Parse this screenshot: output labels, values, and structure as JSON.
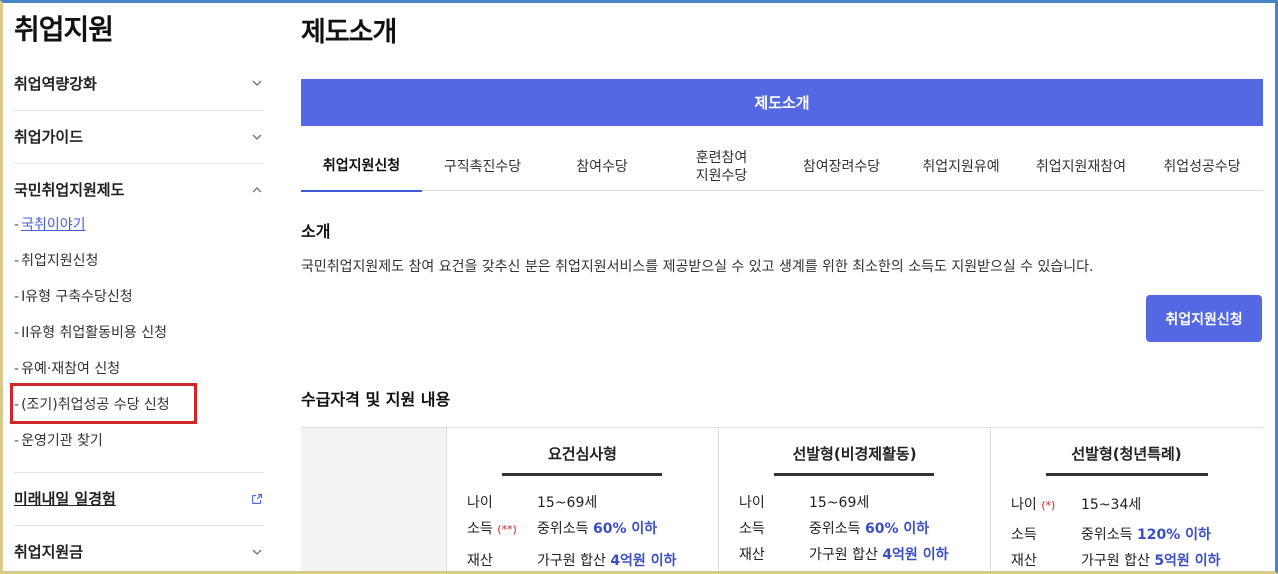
{
  "sidebar": {
    "title": "취업지원",
    "menus": [
      {
        "label": "취업역량강화"
      },
      {
        "label": "취업가이드"
      },
      {
        "label": "국민취업지원제도"
      }
    ],
    "sub_items": [
      {
        "dash": "-",
        "label": "국취이야기"
      },
      {
        "dash": "-",
        "label": "취업지원신청"
      },
      {
        "dash": "-",
        "label": "I유형 구축수당신청"
      },
      {
        "dash": "-",
        "label": "II유형 취업활동비용 신청"
      },
      {
        "dash": "-",
        "label": "유예·재참여 신청"
      },
      {
        "dash": "-",
        "label": "(조기)취업성공 수당 신청"
      },
      {
        "dash": "-",
        "label": "운영기관 찾기"
      }
    ],
    "bottom_menus": [
      {
        "label": "미래내일 일경험"
      },
      {
        "label": "취업지원금"
      }
    ]
  },
  "main": {
    "title": "제도소개",
    "banner": "제도소개",
    "tabs": [
      {
        "label": "취업지원신청"
      },
      {
        "label": "구직촉진수당"
      },
      {
        "label": "참여수당"
      },
      {
        "label": "훈련참여\n지원수당"
      },
      {
        "label": "참여장려수당"
      },
      {
        "label": "취업지원유예"
      },
      {
        "label": "취업지원재참여"
      },
      {
        "label": "취업성공수당"
      }
    ],
    "intro_title": "소개",
    "intro_text": "국민취업지원제도 참여 요건을 갖추신 분은 취업지원서비스를 제공받으실 수 있고 생계를 위한 최소한의 소득도 지원받으실 수 있습니다.",
    "apply_button": "취업지원신청",
    "eligibility_title": "수급자격 및 지원 내용",
    "columns": [
      {
        "header": "요건심사형",
        "rows": [
          {
            "label": "나이",
            "star": "",
            "value": "15~69세",
            "highlight": ""
          },
          {
            "label": "소득",
            "star": "(**)",
            "value": "중위소득 ",
            "highlight": "60% 이하"
          },
          {
            "label": "재산",
            "star": "",
            "value": "가구원 합산 ",
            "highlight": "4억원 이하"
          }
        ]
      },
      {
        "header": "선발형(비경제활동)",
        "rows": [
          {
            "label": "나이",
            "star": "",
            "value": "15~69세",
            "highlight": ""
          },
          {
            "label": "소득",
            "star": "",
            "value": "중위소득 ",
            "highlight": "60% 이하"
          },
          {
            "label": "재산",
            "star": "",
            "value": "가구원 합산 ",
            "highlight": "4억원 이하"
          }
        ]
      },
      {
        "header": "선발형(청년특례)",
        "rows": [
          {
            "label": "나이",
            "star": "(*)",
            "value": "15~34세",
            "highlight": ""
          },
          {
            "label": "소득",
            "star": "",
            "value": "중위소득 ",
            "highlight": "120% 이하"
          },
          {
            "label": "재산",
            "star": "",
            "value": "가구원 합산 ",
            "highlight": "5억원 이하"
          }
        ]
      }
    ]
  },
  "colors": {
    "accent": "#5468e3",
    "highlight_box": "#d0252b",
    "link": "#4a5fd8"
  },
  "icons": {
    "chevron_down": "chevron-down-icon",
    "chevron_up": "chevron-up-icon",
    "external": "external-link-icon"
  }
}
